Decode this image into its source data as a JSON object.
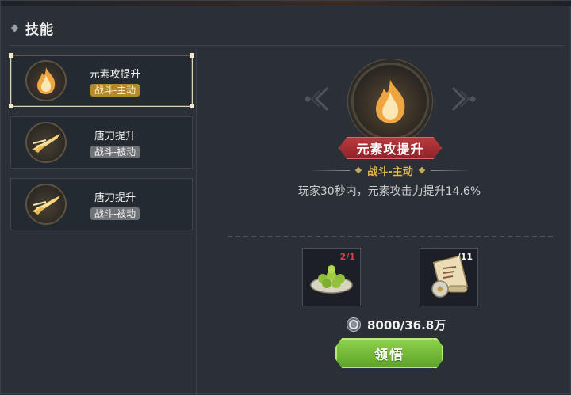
{
  "header": {
    "title": "技能"
  },
  "skills": [
    {
      "name": "元素攻提升",
      "tag": "战斗-主动",
      "icon": "fire-icon",
      "selected": true
    },
    {
      "name": "唐刀提升",
      "tag": "战斗-被动",
      "icon": "blade-icon",
      "selected": false
    },
    {
      "name": "唐刀提升",
      "tag": "战斗-被动",
      "icon": "blade-icon",
      "selected": false
    }
  ],
  "detail": {
    "name": "元素攻提升",
    "type": "战斗-主动",
    "description": "玩家30秒内，元素攻击力提升14.6%",
    "icon": "fire-icon"
  },
  "materials": [
    {
      "icon": "green-fruit-plate-icon",
      "count": "2/1"
    },
    {
      "icon": "scroll-icon",
      "count": "/11"
    }
  ],
  "cost": {
    "icon": "coin-icon",
    "text": "8000/36.8万"
  },
  "action": {
    "label": "领悟"
  },
  "colors": {
    "active_tag": "#b38a2e",
    "passive_tag": "#6f7276",
    "banner": "#b93a3e",
    "button": "#7cc23c",
    "count_red": "#e0403c"
  }
}
